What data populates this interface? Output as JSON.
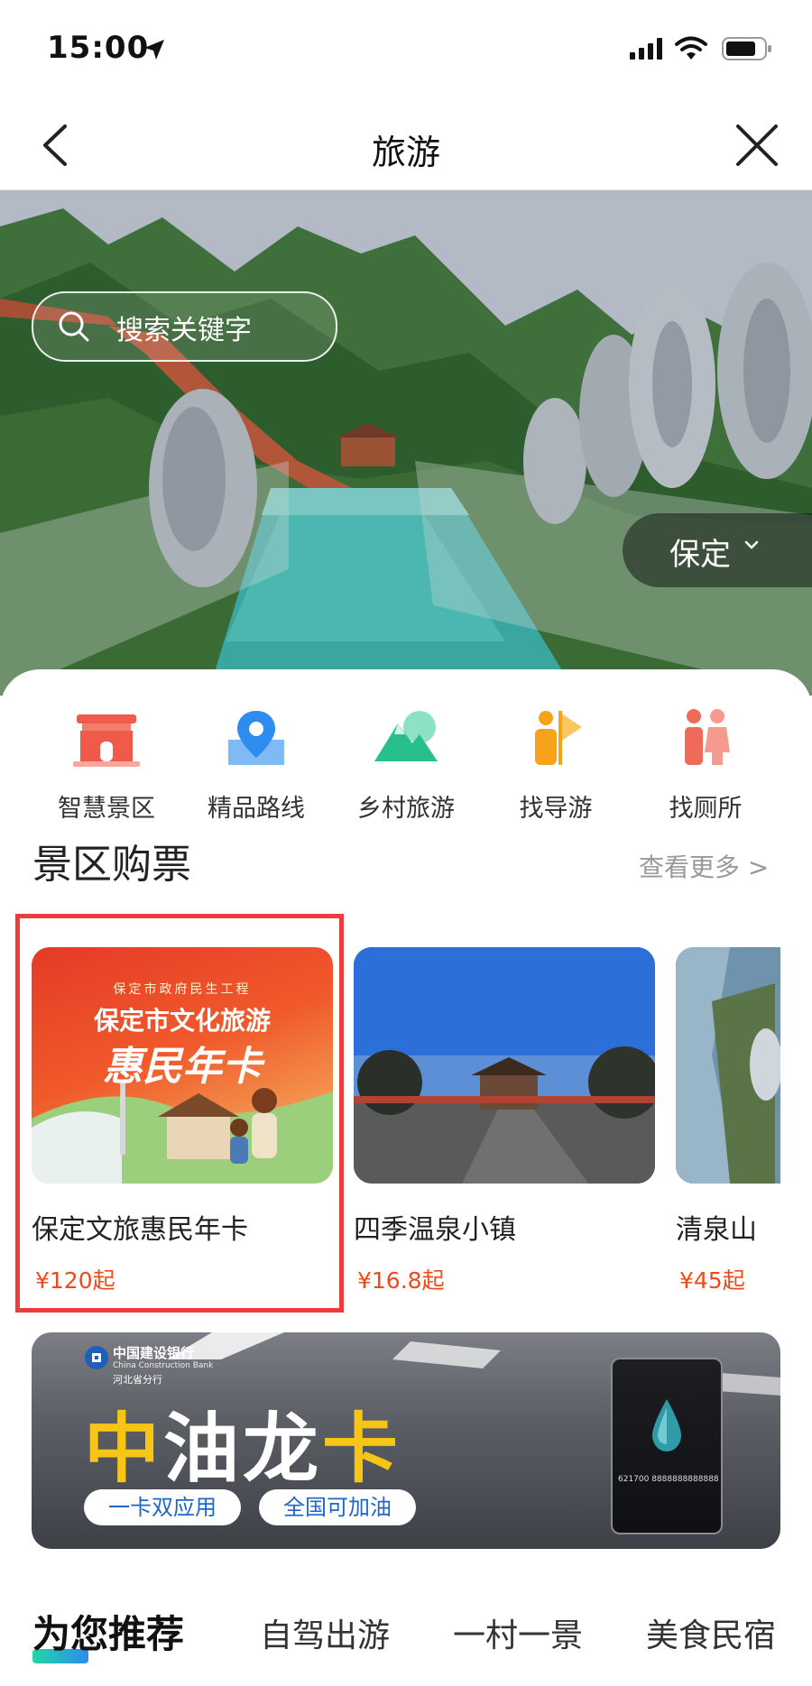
{
  "status_bar": {
    "time": "15:00",
    "icons": [
      "location-arrow-icon",
      "signal-icon",
      "wifi-icon",
      "battery-icon"
    ]
  },
  "nav": {
    "title": "旅游",
    "back_icon": "chevron-left-icon",
    "close_icon": "close-icon"
  },
  "hero": {
    "search_placeholder": "搜索关键字",
    "city": "保定"
  },
  "categories": [
    {
      "label": "智慧景区",
      "icon": "scenic-gate-icon",
      "color": "#f05a4a"
    },
    {
      "label": "精品路线",
      "icon": "map-pin-icon",
      "color": "#2e8cf0"
    },
    {
      "label": "乡村旅游",
      "icon": "mountain-icon",
      "color": "#27c08a"
    },
    {
      "label": "找导游",
      "icon": "guide-flag-icon",
      "color": "#f7a21b"
    },
    {
      "label": "找厕所",
      "icon": "restroom-icon",
      "color": "#f06a5a"
    }
  ],
  "tickets_section": {
    "title": "景区购票",
    "more": "查看更多 >",
    "items": [
      {
        "name": "保定文旅惠民年卡",
        "currency": "¥",
        "price": "120",
        "suffix": "起",
        "image": {
          "small": "保定市政府民生工程",
          "title": "保定市文化旅游",
          "big": "惠民年卡"
        }
      },
      {
        "name": "四季温泉小镇",
        "currency": "¥",
        "price": "16.8",
        "suffix": "起"
      },
      {
        "name": "清泉山",
        "currency": "¥",
        "price": "45",
        "suffix": "起"
      }
    ]
  },
  "banner": {
    "bank_name": "中国建设银行",
    "bank_en": "China Construction Bank",
    "bank_branch": "河北省分行",
    "title_part1": "中",
    "title_part2": "油",
    "title_part3": "龙",
    "title_part4": "卡",
    "tags": [
      "一卡双应用",
      "全国可加油"
    ],
    "card_number": "621700 8888888888888"
  },
  "tabs": {
    "items": [
      "为您推荐",
      "自驾出游",
      "一村一景",
      "美食民宿"
    ],
    "active_index": 0
  },
  "colors": {
    "highlight_border": "#ee3b3b",
    "price": "#f04a1c",
    "tab_accent_start": "#23d6a5",
    "tab_accent_end": "#2a8cf0"
  }
}
